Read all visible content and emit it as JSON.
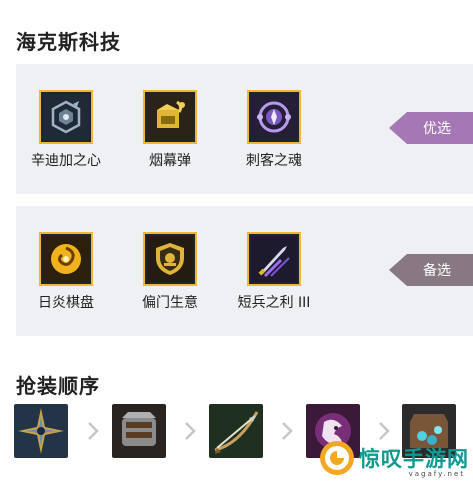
{
  "sections": {
    "tech_title": "海克斯科技",
    "order_title": "抢装顺序"
  },
  "panel1": {
    "tag": "优选",
    "tag_color": "#a677b5",
    "items": [
      {
        "label": "辛迪加之心",
        "icon": "syndicate-heart-icon"
      },
      {
        "label": "烟幕弹",
        "icon": "smoke-bomb-icon"
      },
      {
        "label": "刺客之魂",
        "icon": "assassin-soul-icon"
      }
    ]
  },
  "panel2": {
    "tag": "备选",
    "tag_color": "#877882",
    "items": [
      {
        "label": "日炎棋盘",
        "icon": "sunfire-board-icon"
      },
      {
        "label": "偏门生意",
        "icon": "side-business-icon"
      },
      {
        "label": "短兵之利 III",
        "icon": "dagger-edge-icon"
      }
    ]
  },
  "build_order": [
    "shuriken-item-icon",
    "armor-gauntlet-item-icon",
    "bow-arrow-item-icon",
    "dragon-claw-item-icon",
    "crystal-vest-item-icon"
  ],
  "watermark": {
    "text": "惊叹手游网",
    "sub": "vagafy.net"
  }
}
